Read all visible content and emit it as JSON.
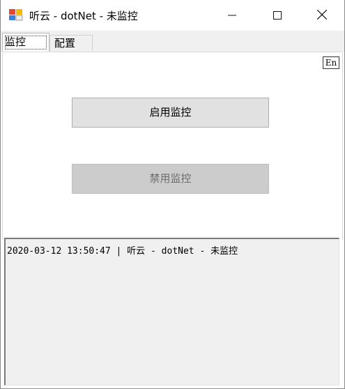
{
  "window": {
    "title": "听云 - dotNet - 未监控",
    "icon": "app-icon",
    "controls": {
      "minimize": "minimize-icon",
      "maximize": "maximize-icon",
      "close": "close-icon"
    }
  },
  "tabs": [
    {
      "label": "监控",
      "active": true
    },
    {
      "label": "配置",
      "active": false
    }
  ],
  "monitor": {
    "language_button": "En",
    "enable_button": "启用监控",
    "disable_button": "禁用监控",
    "disable_enabled": false
  },
  "log": {
    "lines": [
      "2020-03-12 13:50:47 | 听云 - dotNet - 未监控"
    ]
  },
  "colors": {
    "button_face": "#e1e1e1",
    "button_disabled": "#cccccc",
    "disabled_text": "#6d6d6d",
    "tab_strip": "#f0f0f0",
    "log_background": "#f0f0f0"
  }
}
